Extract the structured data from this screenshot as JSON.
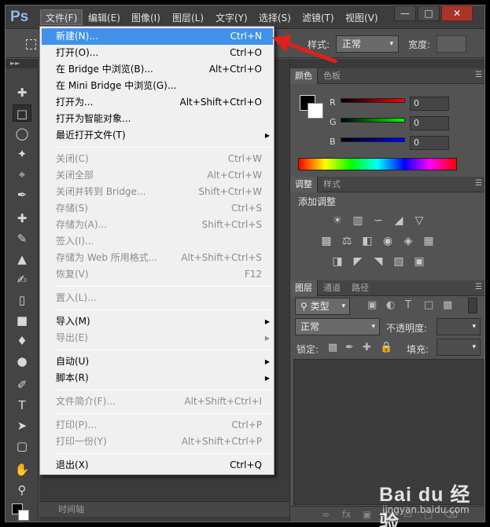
{
  "app": {
    "logo": "Ps"
  },
  "menubar": {
    "items": [
      "文件(F)",
      "编辑(E)",
      "图像(I)",
      "图层(L)",
      "文字(Y)",
      "选择(S)",
      "滤镜(T)",
      "视图(V)"
    ],
    "window_buttons": {
      "minimize": "—",
      "maximize": "□",
      "close": "✕"
    }
  },
  "optionsbar": {
    "style_label": "样式:",
    "style_value": "正常",
    "width_label": "宽度:"
  },
  "file_menu": {
    "groups": [
      [
        {
          "label": "新建(N)...",
          "shortcut": "Ctrl+N",
          "state": "highlighted"
        },
        {
          "label": "打开(O)...",
          "shortcut": "Ctrl+O"
        },
        {
          "label": "在 Bridge 中浏览(B)...",
          "shortcut": "Alt+Ctrl+O"
        },
        {
          "label": "在 Mini Bridge 中浏览(G)...",
          "shortcut": ""
        },
        {
          "label": "打开为...",
          "shortcut": "Alt+Shift+Ctrl+O"
        },
        {
          "label": "打开为智能对象...",
          "shortcut": ""
        },
        {
          "label": "最近打开文件(T)",
          "shortcut": "",
          "submenu": true
        }
      ],
      [
        {
          "label": "关闭(C)",
          "shortcut": "Ctrl+W",
          "state": "disabled"
        },
        {
          "label": "关闭全部",
          "shortcut": "Alt+Ctrl+W",
          "state": "disabled"
        },
        {
          "label": "关闭并转到 Bridge...",
          "shortcut": "Shift+Ctrl+W",
          "state": "disabled"
        },
        {
          "label": "存储(S)",
          "shortcut": "Ctrl+S",
          "state": "disabled"
        },
        {
          "label": "存储为(A)...",
          "shortcut": "Shift+Ctrl+S",
          "state": "disabled"
        },
        {
          "label": "签入(I)...",
          "shortcut": "",
          "state": "disabled"
        },
        {
          "label": "存储为 Web 所用格式...",
          "shortcut": "Alt+Shift+Ctrl+S",
          "state": "disabled"
        },
        {
          "label": "恢复(V)",
          "shortcut": "F12",
          "state": "disabled"
        }
      ],
      [
        {
          "label": "置入(L)...",
          "shortcut": "",
          "state": "disabled"
        }
      ],
      [
        {
          "label": "导入(M)",
          "shortcut": "",
          "submenu": true
        },
        {
          "label": "导出(E)",
          "shortcut": "",
          "submenu": true,
          "state": "disabled"
        }
      ],
      [
        {
          "label": "自动(U)",
          "shortcut": "",
          "submenu": true
        },
        {
          "label": "脚本(R)",
          "shortcut": "",
          "submenu": true
        }
      ],
      [
        {
          "label": "文件简介(F)...",
          "shortcut": "Alt+Shift+Ctrl+I",
          "state": "disabled"
        }
      ],
      [
        {
          "label": "打印(P)...",
          "shortcut": "Ctrl+P",
          "state": "disabled"
        },
        {
          "label": "打印一份(Y)",
          "shortcut": "Alt+Shift+Ctrl+P",
          "state": "disabled"
        }
      ],
      [
        {
          "label": "退出(X)",
          "shortcut": "Ctrl+Q"
        }
      ]
    ]
  },
  "color_panel": {
    "tabs": [
      "颜色",
      "色板"
    ],
    "channels": [
      {
        "label": "R",
        "value": "0",
        "gradient_end": "#ff0000"
      },
      {
        "label": "G",
        "value": "0",
        "gradient_end": "#00ff00"
      },
      {
        "label": "B",
        "value": "0",
        "gradient_end": "#0000ff"
      }
    ]
  },
  "adjust_panel": {
    "tabs": [
      "调整",
      "样式"
    ],
    "title": "添加调整"
  },
  "layers_panel": {
    "tabs": [
      "图层",
      "通道",
      "路径"
    ],
    "filter_label": "类型",
    "blend_mode": "正常",
    "opacity_label": "不透明度:",
    "lock_label": "锁定:",
    "fill_label": "填充:"
  },
  "timeline": {
    "label": "时间轴"
  },
  "watermark": {
    "brand": "Bai du 经验",
    "site": "jingyan.baidu.com"
  },
  "colors": {
    "highlight": "#3f92e8",
    "annotation_arrow": "#e0201b"
  }
}
